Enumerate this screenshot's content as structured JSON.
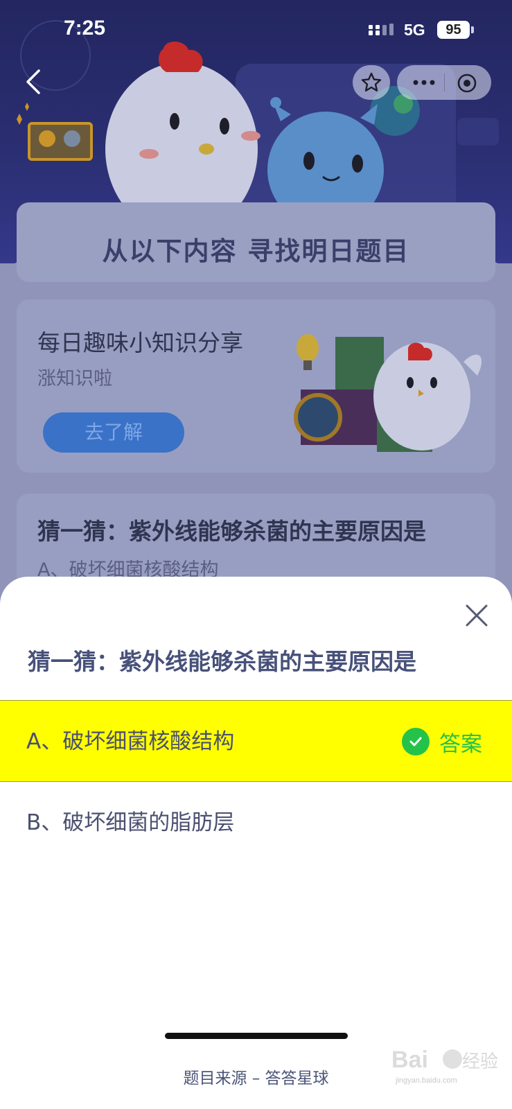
{
  "status_bar": {
    "time": "7:25",
    "network": "5G",
    "battery": "95"
  },
  "nav": {
    "back_icon": "chevron-left-icon",
    "favorite_icon": "star-icon",
    "more_icon": "more-dots-icon",
    "close_mini_icon": "target-circle-icon"
  },
  "background_page": {
    "section_title": "从以下内容  寻找明日题目",
    "knowledge_card": {
      "title": "每日趣味小知识分享",
      "subtitle": "涨知识啦",
      "button_label": "去了解"
    },
    "guess_card": {
      "title": "猜一猜：紫外线能够杀菌的主要原因是",
      "option_a": "A、破坏细菌核酸结构"
    }
  },
  "sheet": {
    "question": "猜一猜：紫外线能够杀菌的主要原因是",
    "options": [
      {
        "label": "A、破坏细菌核酸结构",
        "is_answer": true,
        "answer_tag": "答案"
      },
      {
        "label": "B、破坏细菌的脂肪层",
        "is_answer": false
      }
    ],
    "source": "题目来源 – 答答星球",
    "colors": {
      "highlight": "#ffff00",
      "answer_green": "#25c24a",
      "question_text": "#47517a"
    }
  },
  "watermark": {
    "text": "Baidu经验",
    "subtext": "jingyan.baidu.com"
  }
}
